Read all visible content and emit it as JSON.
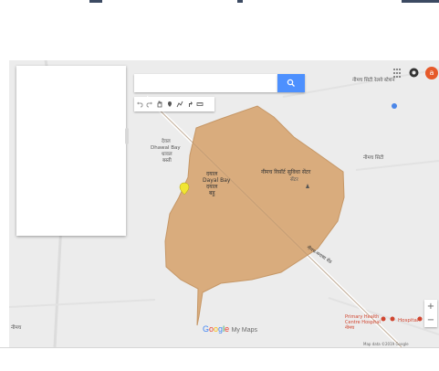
{
  "search": {
    "placeholder": "",
    "value": "",
    "button_icon": "search-icon"
  },
  "toolbar": {
    "tools": [
      "undo-icon",
      "redo-icon",
      "hand-icon",
      "marker-icon",
      "draw-line-icon",
      "directions-icon",
      "ruler-icon"
    ]
  },
  "account": {
    "avatar_letter": "a"
  },
  "branding": {
    "google_letters": [
      "G",
      "o",
      "o",
      "g",
      "l",
      "e"
    ],
    "my_maps": "My Maps"
  },
  "map_labels": {
    "top_right_place": "नीमच सिटी रेलवे स्टेशन",
    "area_main_line1": "दयाल",
    "area_main_line2": "Dayal Bay",
    "area_main_line3": "दयाल",
    "area_main_line4": "बहु ",
    "left_area_line1": "देवल",
    "left_area_line2": "Dhawal Bay",
    "left_area_line3": "धावल",
    "left_area_line4": "बस्ती",
    "temple_line1": "नीमच रिसॉर्ट सुविधा सेंटर",
    "temple_line2": "सेंटर",
    "right_area": "नीमच सिटी",
    "road": "नीमच-मनासा रोड",
    "bottom_left": "नीमच",
    "bottom_place_line1": "Primary Health",
    "bottom_place_line2": "Centre Hospital",
    "bottom_place_line3": "नीमच",
    "bottom_right_place": "Hospital",
    "attribution": "Map data ©2019 Google"
  },
  "colors": {
    "area_fill": "#d9a978",
    "area_stroke": "#c4935f",
    "search_blue": "#4d90fe",
    "avatar": "#e65a2a",
    "marker": "#f1e532"
  }
}
